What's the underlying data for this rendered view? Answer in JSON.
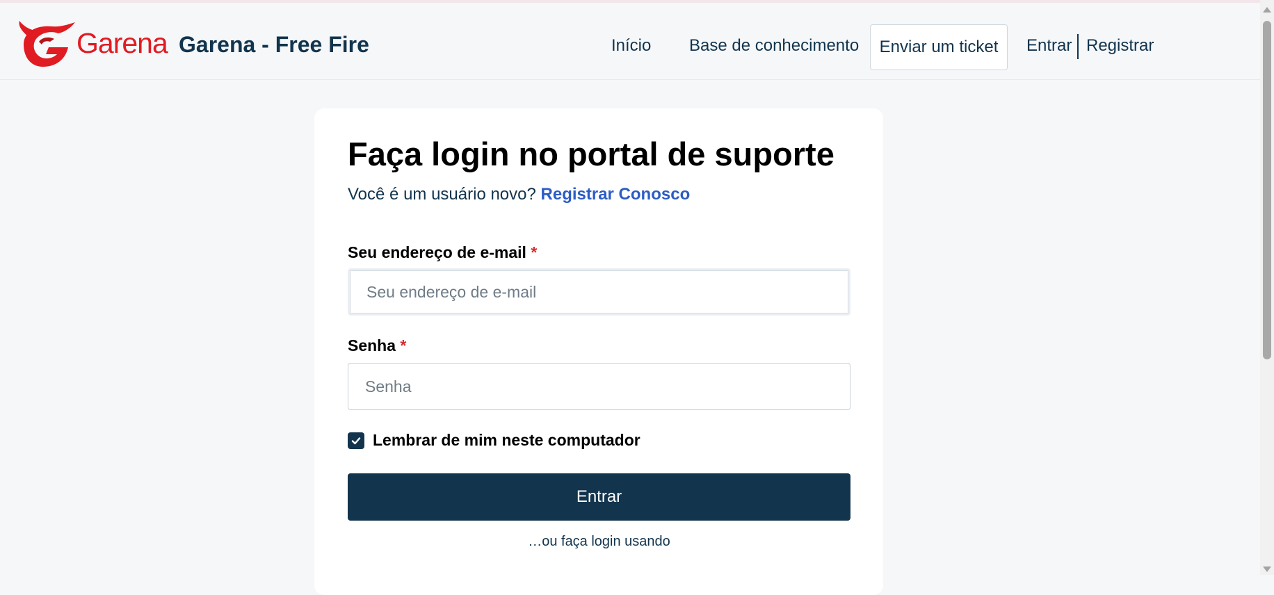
{
  "header": {
    "logo_text": "Garena",
    "portal_name": "Garena - Free Fire",
    "nav": {
      "home": "Início",
      "knowledge_base": "Base de conhecimento",
      "submit_ticket": "Enviar um ticket",
      "login": "Entrar",
      "register": "Registrar"
    }
  },
  "login_card": {
    "title": "Faça login no portal de suporte",
    "new_user_prompt": "Você é um usuário novo?",
    "register_link": "Registrar Conosco",
    "email": {
      "label": "Seu endereço de e-mail",
      "required_mark": "*",
      "placeholder": "Seu endereço de e-mail",
      "value": ""
    },
    "password": {
      "label": "Senha",
      "required_mark": "*",
      "placeholder": "Senha",
      "value": ""
    },
    "remember_me": {
      "label": "Lembrar de mim neste computador",
      "checked": true
    },
    "submit_label": "Entrar",
    "alt_login_text": "…ou faça login usando"
  },
  "colors": {
    "brand_red": "#e11b22",
    "primary_dark": "#12344d",
    "link_blue": "#2c5cc5",
    "required_red": "#d72d30",
    "page_bg": "#f5f7f9"
  },
  "icons": {
    "logo": "garena-dragon-logo",
    "checkbox": "checkmark-icon"
  }
}
